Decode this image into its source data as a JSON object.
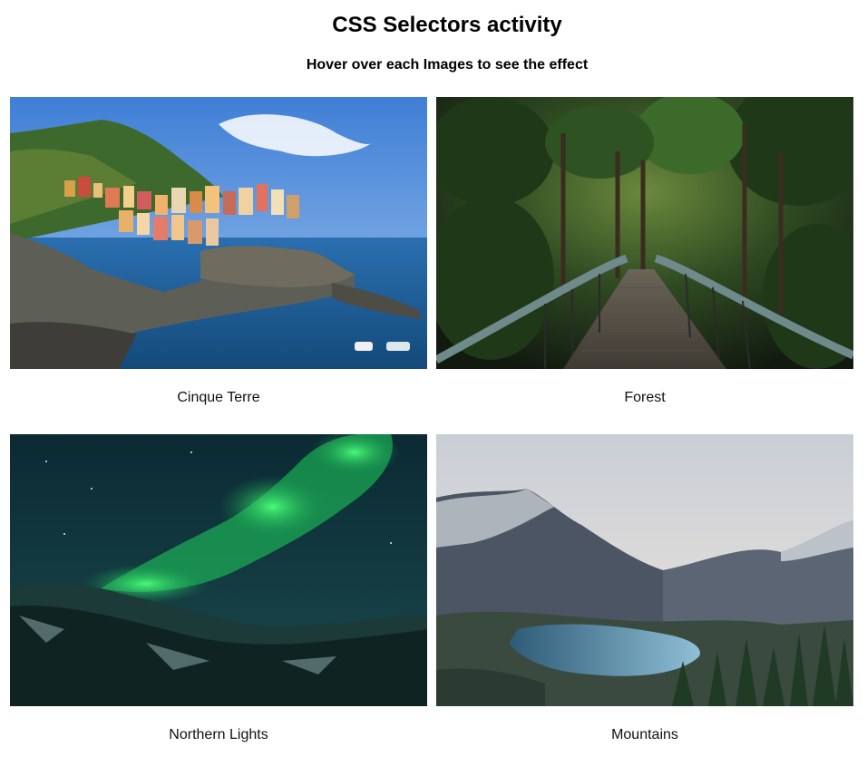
{
  "page": {
    "title": "CSS Selectors activity",
    "subtitle": "Hover over each Images to see the effect"
  },
  "gallery": {
    "items": [
      {
        "caption": "Cinque Terre",
        "icon": "cinque-terre-photo"
      },
      {
        "caption": "Forest",
        "icon": "forest-bridge-photo"
      },
      {
        "caption": "Northern Lights",
        "icon": "aurora-photo"
      },
      {
        "caption": "Mountains",
        "icon": "mountain-lake-photo"
      }
    ]
  },
  "colors": {
    "background": "#ffffff",
    "text": "#111111"
  }
}
